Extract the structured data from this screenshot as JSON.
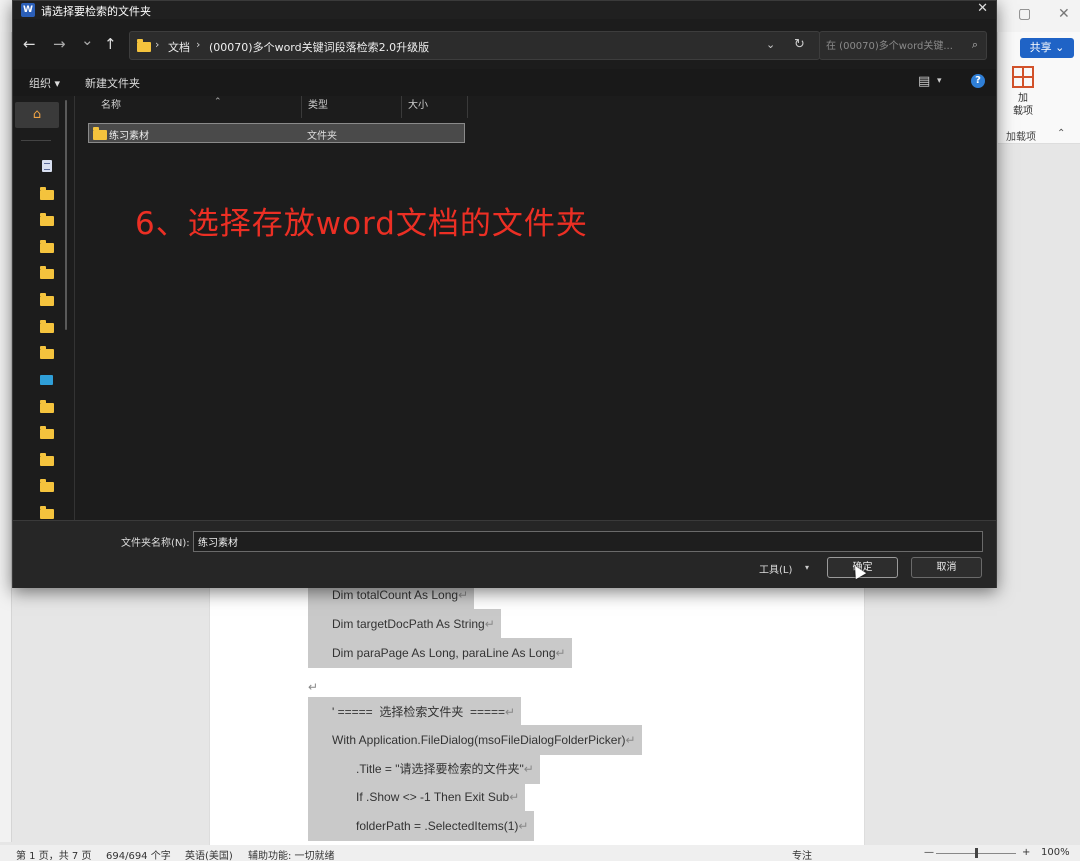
{
  "dialog": {
    "title": "请选择要检索的文件夹",
    "app_icon_letter": "W",
    "close_glyph": "✕",
    "nav": {
      "back": "←",
      "forward": "→",
      "recent": "⌄",
      "up": "↑"
    },
    "address": {
      "crumbs": [
        "文档",
        "(00070)多个word关键词段落检索2.0升级版"
      ],
      "separator": "›",
      "dropdown_glyph": "⌄",
      "refresh_glyph": "↻"
    },
    "search": {
      "placeholder": "在 (00070)多个word关键...",
      "icon": "⌕"
    },
    "toolbar": {
      "organize": "组织 ▾",
      "new_folder": "新建文件夹",
      "view_glyph": "▤",
      "view_caret": "▾",
      "help": "?"
    },
    "columns": {
      "name": "名称",
      "type": "类型",
      "size": "大小",
      "sort_glyph": "⌃"
    },
    "files": [
      {
        "name": "练习素材",
        "type": "文件夹",
        "size": ""
      }
    ],
    "nav_pane": {
      "home_glyph": "⌂"
    },
    "annotation": "6、选择存放word文档的文件夹",
    "folder_name_label": "文件夹名称(N):",
    "folder_name_value": "练习素材",
    "tools_label": "工具(L)",
    "tools_caret": "▾",
    "ok_label": "确定",
    "cancel_label": "取消"
  },
  "word": {
    "share_label": "共享 ⌄",
    "addin_label_line1": "加",
    "addin_label_line2": "载项",
    "addin_group": "加载项",
    "collapse_glyph": "⌃",
    "win_min": "▢",
    "win_close": "✕",
    "para_mark": "↵",
    "code_lines": [
      "Dim totalCount As Long",
      "Dim targetDocPath As String",
      "Dim paraPage As Long, paraLine As Long",
      "",
      "' =====  选择检索文件夹  =====",
      "With Application.FileDialog(msoFileDialogFolderPicker)",
      ".Title = \"请选择要检索的文件夹\"",
      "If .Show <> -1 Then Exit Sub",
      "folderPath = .SelectedItems(1)"
    ],
    "status": {
      "page": "第 1 页，共 7 页",
      "words": "694/694 个字",
      "language": "英语(美国)",
      "accessibility": "辅助功能: 一切就绪",
      "focus": "专注",
      "zoom": "100%",
      "zoom_minus": "—",
      "zoom_plus": "+"
    }
  }
}
